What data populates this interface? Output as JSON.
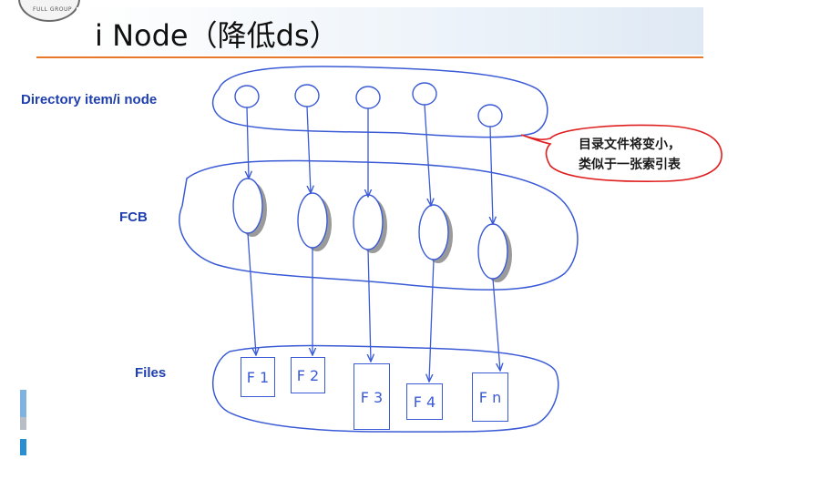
{
  "slide": {
    "title": "i Node（降低ds）",
    "logo_text": "FULL GROUP"
  },
  "diagram": {
    "row_labels": {
      "directory": "Directory item/i node",
      "fcb": "FCB",
      "files": "Files"
    },
    "callout_lines": [
      "目录文件将变小，",
      "类似于一张索引表"
    ],
    "files": [
      "F 1",
      "F 2",
      "F 3",
      "F 4",
      "F n"
    ]
  },
  "colors": {
    "accent_line": "#e8782a",
    "diagram_blue": "#3b5bd6",
    "label_blue": "#1f3fae",
    "callout_red": "#e02020"
  }
}
